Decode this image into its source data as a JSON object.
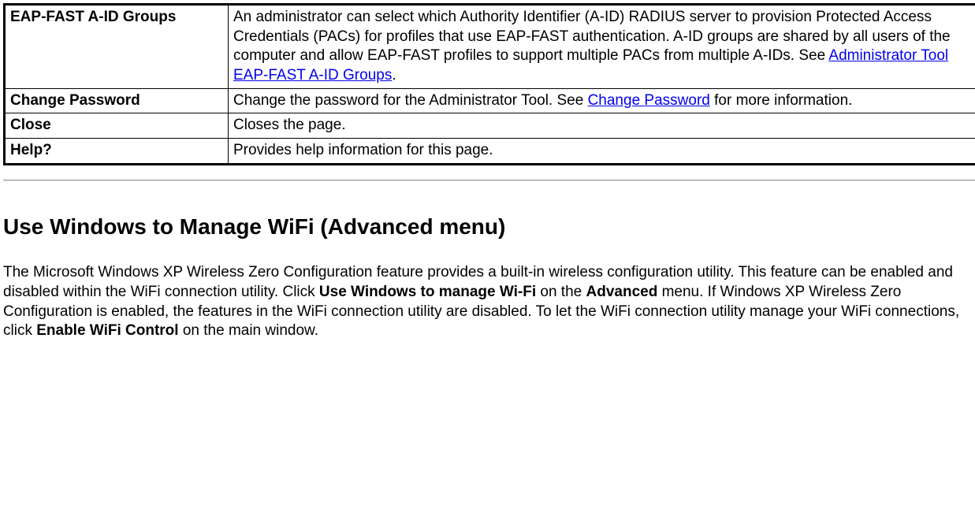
{
  "table": {
    "rows": [
      {
        "name": "EAP-FAST A-ID Groups",
        "desc_before": "An administrator can select which Authority Identifier (A-ID) RADIUS server to provision Protected Access Credentials (PACs) for profiles that use EAP-FAST authentication. A-ID groups are shared by all users of the computer and allow EAP-FAST profiles to support multiple PACs from multiple A-IDs. See ",
        "link_text": "Administrator Tool EAP-FAST A-ID Groups",
        "desc_after": "."
      },
      {
        "name": "Change Password",
        "desc_before": "Change the password for the Administrator Tool. See ",
        "link_text": "Change Password",
        "desc_after": " for more information."
      },
      {
        "name": "Close",
        "desc_before": "Closes the page.",
        "link_text": "",
        "desc_after": ""
      },
      {
        "name": "Help?",
        "desc_before": "Provides help information for this page.",
        "link_text": "",
        "desc_after": ""
      }
    ]
  },
  "section": {
    "heading": "Use Windows to Manage WiFi (Advanced menu)",
    "p1_a": "The Microsoft Windows XP Wireless Zero Configuration feature provides a built-in wireless configuration utility. This feature can be enabled and disabled within the WiFi connection utility. Click ",
    "p1_bold1": "Use Windows to manage Wi-Fi",
    "p1_b": " on the ",
    "p1_bold2": "Advanced",
    "p1_c": " menu. If Windows XP Wireless Zero Configuration is enabled, the features in the WiFi connection utility are disabled. To let the WiFi connection utility manage your WiFi connections, click ",
    "p1_bold3": "Enable WiFi Control",
    "p1_d": " on the main window."
  }
}
